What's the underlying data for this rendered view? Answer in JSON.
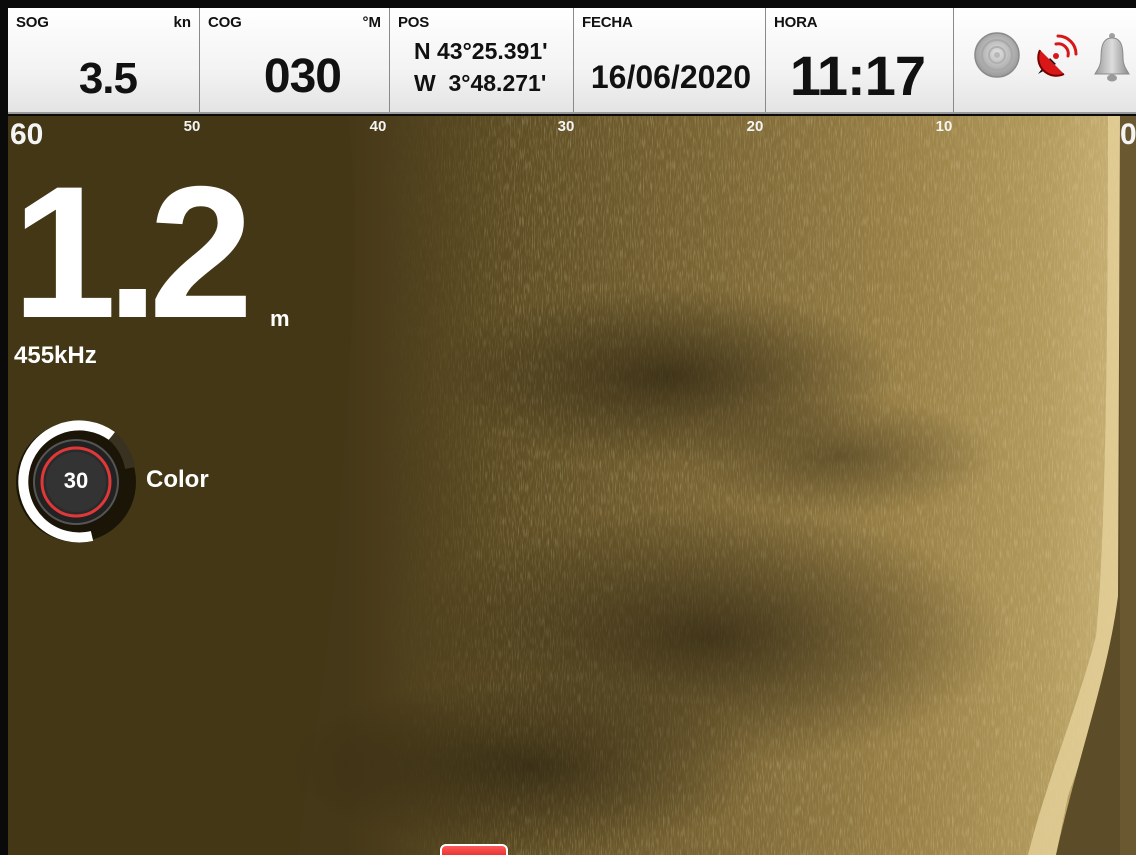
{
  "databar": {
    "sog": {
      "label": "SOG",
      "unit": "kn",
      "value": "3.5"
    },
    "cog": {
      "label": "COG",
      "unit": "°M",
      "value": "030"
    },
    "pos": {
      "label": "POS",
      "lat": "N 43°25.391'",
      "lon": "W  3°48.271'"
    },
    "fecha": {
      "label": "FECHA",
      "value": "16/06/2020"
    },
    "hora": {
      "label": "HORA",
      "value": "11:17"
    },
    "status_icons": [
      "sonar-status-icon",
      "gps-status-icon",
      "alarm-bell-icon"
    ]
  },
  "sonar": {
    "range_labels": {
      "r60": "60",
      "r50": "50",
      "r40": "40",
      "r30": "30",
      "r20": "20",
      "r10": "10",
      "r0": "0"
    },
    "depth": "1.2",
    "depth_unit": "m",
    "frequency": "455kHz",
    "color_control": {
      "value": "30",
      "label": "Color"
    }
  },
  "colors": {
    "sonar_dark": "#433716",
    "sonar_light": "#b9a064",
    "alarm_red": "#e02020",
    "gps_red": "#d81818"
  }
}
